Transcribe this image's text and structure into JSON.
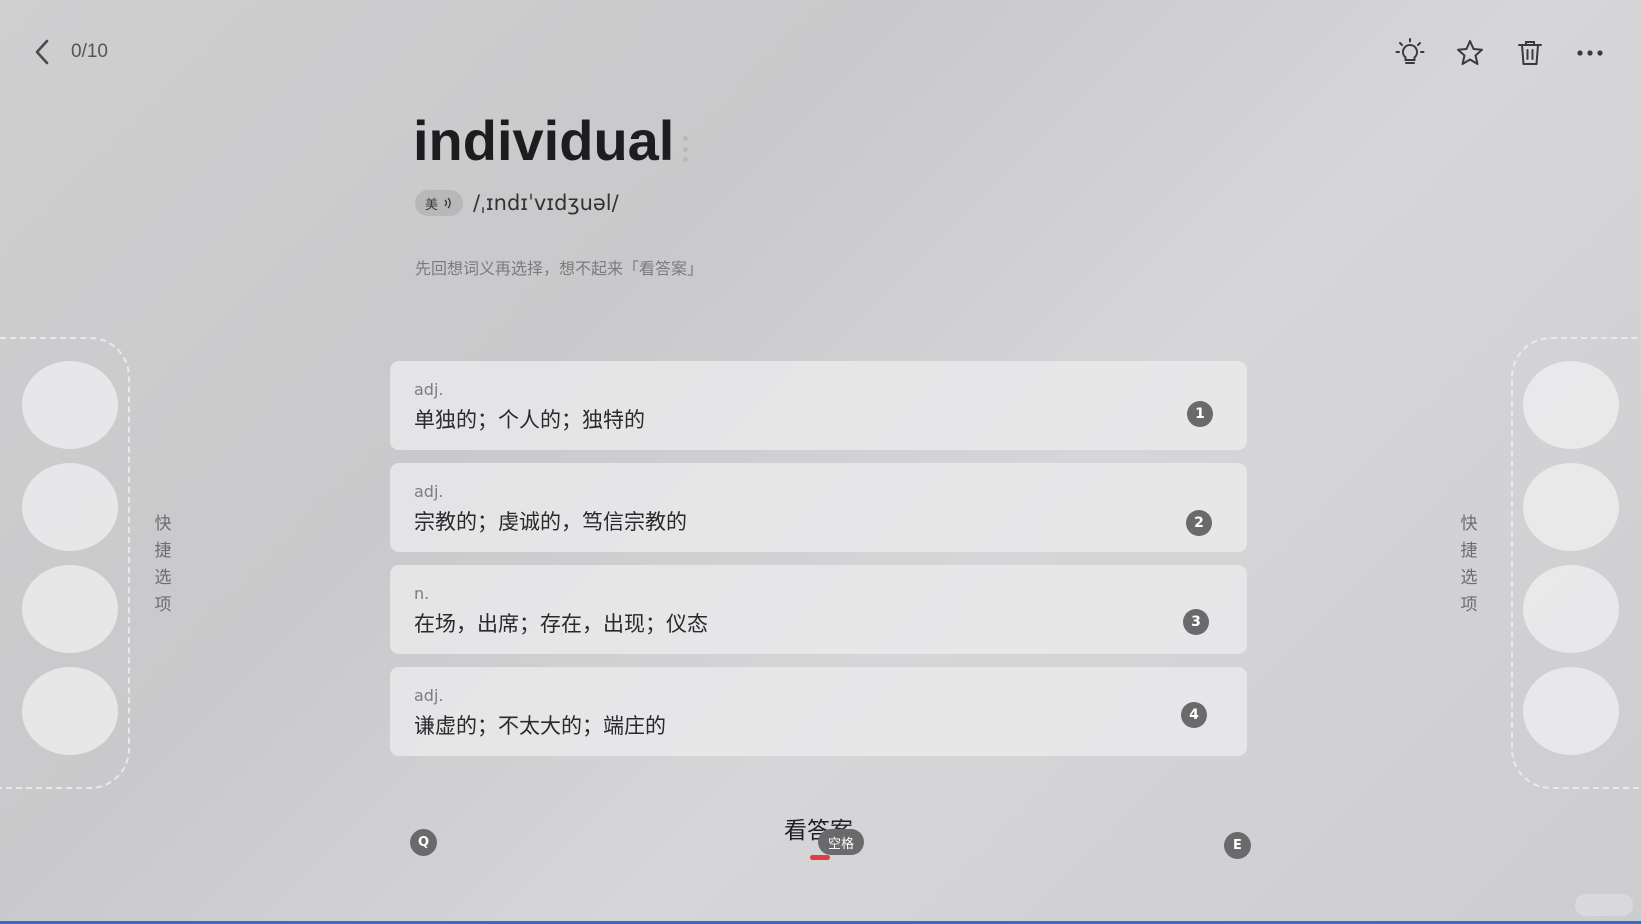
{
  "header": {
    "back_icon": "chevron-left-icon",
    "progress": "0/10",
    "actions": [
      {
        "name": "lightbulb-icon"
      },
      {
        "name": "star-icon"
      },
      {
        "name": "trash-icon"
      },
      {
        "name": "more-icon"
      }
    ]
  },
  "word": {
    "text": "individual",
    "region": "美",
    "phonetic": "/ˌɪndɪˈvɪdʒuəl/",
    "hint": "先回想词义再选择，想不起来「看答案」"
  },
  "options": [
    {
      "pos": "adj.",
      "meaning": "单独的；个人的；独特的",
      "key": "1"
    },
    {
      "pos": "adj.",
      "meaning": "宗教的；虔诚的，笃信宗教的",
      "key": "2"
    },
    {
      "pos": "n.",
      "meaning": "在场，出席；存在，出现；仪态",
      "key": "3"
    },
    {
      "pos": "adj.",
      "meaning": "谦虚的；不太大的；端庄的",
      "key": "4"
    }
  ],
  "side": {
    "left_label": "快捷选项",
    "right_label": "快捷选项"
  },
  "footer": {
    "left_key": "Q",
    "show_answer": "看答案",
    "space_key": "空格",
    "right_key": "E"
  },
  "colors": {
    "accent": "#e23c45",
    "key_badge": "#6a6a6d"
  }
}
